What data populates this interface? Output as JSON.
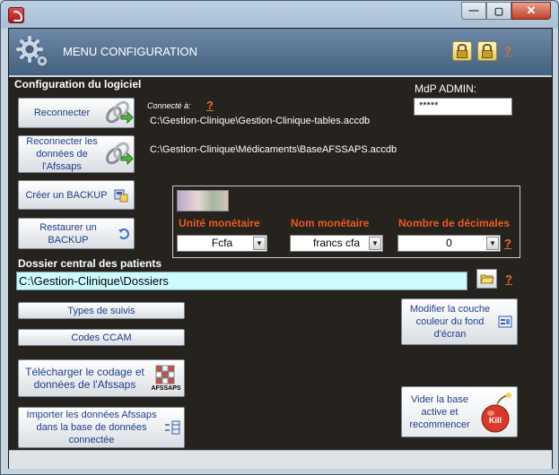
{
  "window": {
    "title": ""
  },
  "header": {
    "title": "MENU CONFIGURATION",
    "help": "?"
  },
  "config": {
    "section_title": "Configuration du logiciel",
    "connected_label": "Connecté à:",
    "connected_help": "?",
    "db_path": "C:\\Gestion-Clinique\\Gestion-Clinique-tables.accdb",
    "afssaps_path": "C:\\Gestion-Clinique\\Médicaments\\BaseAFSSAPS.accdb",
    "mdp_label": "MdP ADMIN:",
    "mdp_value": "*****"
  },
  "buttons": {
    "reconnect": "Reconnecter",
    "reconnect_afssaps": "Reconnecter les données de l'Afssaps",
    "create_backup": "Créer un BACKUP",
    "restore_backup": "Restaurer un BACKUP",
    "types_suivis": "Types de suivis",
    "codes_ccam": "Codes CCAM",
    "download_afssaps": "Télécharger le codage et données de l'Afssaps",
    "import_afssaps": "Importer les données Afssaps dans la base de données connectée",
    "modify_bg": "Modifier la couche couleur du fond d'écran",
    "reset_db": "Vider la base active et recommencer",
    "afssaps_badge": "AFSSAPS",
    "kill_badge": "Kill"
  },
  "currency": {
    "unit_label": "Unité monétaire",
    "unit_value": "Fcfa",
    "name_label": "Nom monétaire",
    "name_value": "francs cfa",
    "decimals_label": "Nombre de décimales",
    "decimals_value": "0",
    "help": "?"
  },
  "patients": {
    "section_title": "Dossier central des patients",
    "folder_path": "C:\\Gestion-Clinique\\Dossiers",
    "help": "?"
  },
  "colors": {
    "accent_orange": "#e86d2b",
    "background": "#26231f",
    "button_text": "#1c3f8a"
  }
}
